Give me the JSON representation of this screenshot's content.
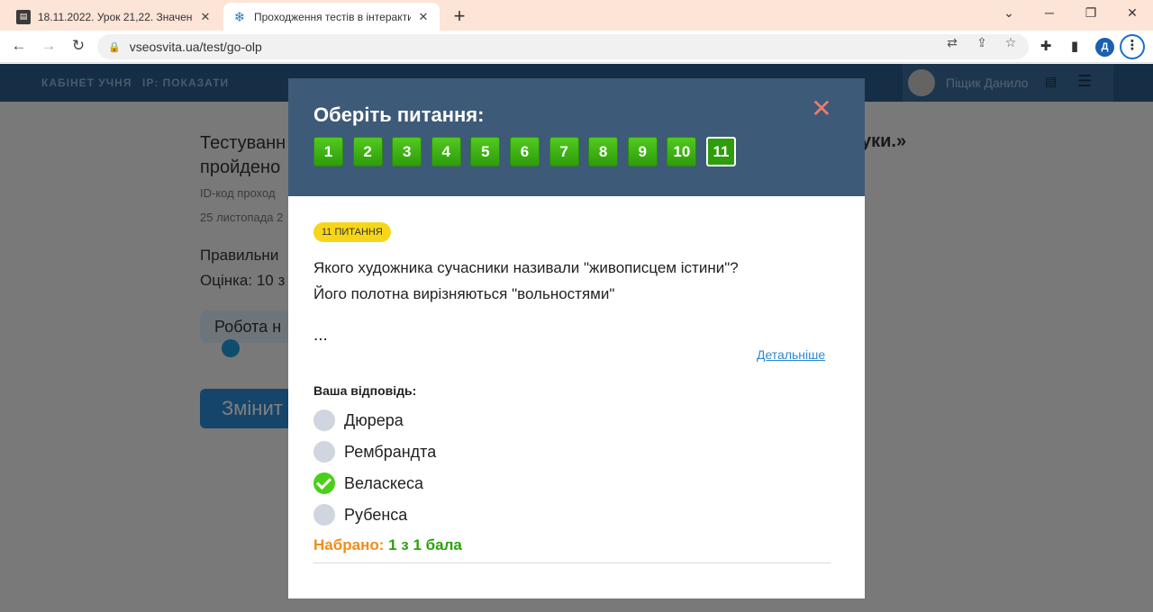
{
  "browser": {
    "tabs": [
      {
        "title": "18.11.2022. Урок 21,22. Значенн",
        "icon": "document-icon"
      },
      {
        "title": "Проходження тестів в інтеракти",
        "icon": "snowflake-icon"
      }
    ],
    "url": "vseosvita.ua/test/go-olp",
    "profile_initial": "Д"
  },
  "site": {
    "nav_cabinet": "КАБІНЕТ УЧНЯ",
    "nav_ip": "IP: ПОКАЗАТИ",
    "user_name": "Піщик Данило"
  },
  "background_page": {
    "title_line1": "Тестуванн",
    "title_line2": "пройдено",
    "title_right": "уки.»",
    "id_code": "ID-код проход",
    "date": "25 листопада 2",
    "correct": "Правильни",
    "grade": "Оцінка: 10 з",
    "progress_label": "Робота н",
    "change_button": "Змінит"
  },
  "modal": {
    "title": "Оберіть питання:",
    "question_numbers": [
      "1",
      "2",
      "3",
      "4",
      "5",
      "6",
      "7",
      "8",
      "9",
      "10",
      "11"
    ],
    "current_question": "11",
    "badge": "11 ПИТАННЯ",
    "question_line1": "Якого художника сучасники називали \"живописцем істини\"?",
    "question_line2": "Його полотна вирізняються \"вольностями\"",
    "ellipsis": "...",
    "details_link": "Детальніше",
    "answer_label": "Ваша відповідь:",
    "options": [
      {
        "text": "Дюрера",
        "selected": false
      },
      {
        "text": "Рембрандта",
        "selected": false
      },
      {
        "text": "Веласкеса",
        "selected": true
      },
      {
        "text": "Рубенса",
        "selected": false
      }
    ],
    "score_label": "Набрано:",
    "score_value": "1 з 1 бала"
  },
  "colors": {
    "header_bg": "#3d5a78",
    "question_button": "#3aae12",
    "badge": "#f7d61a",
    "close": "#f07a6a",
    "score_label": "#f08c1c",
    "score_value": "#2ea00c"
  }
}
